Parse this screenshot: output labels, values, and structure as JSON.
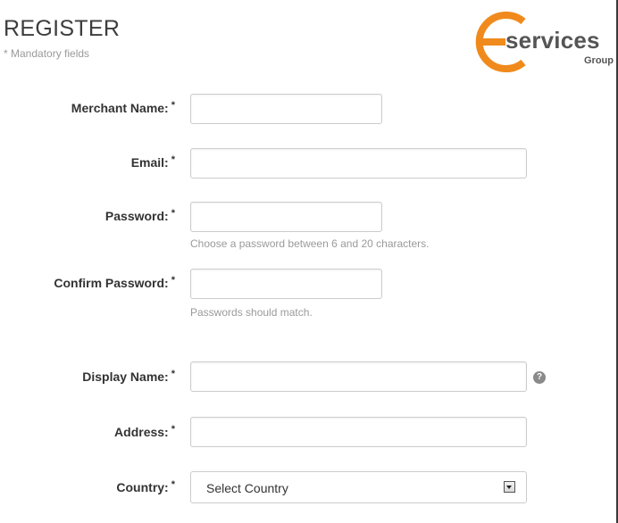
{
  "header": {
    "title": "REGISTER",
    "mandatory_note": "* Mandatory fields"
  },
  "logo": {
    "word": "services",
    "sub": "Group",
    "accent_color": "#f08a1c"
  },
  "form": {
    "required_marker": "*",
    "fields": {
      "merchant_name": {
        "label": "Merchant Name:",
        "value": ""
      },
      "email": {
        "label": "Email:",
        "value": ""
      },
      "password": {
        "label": "Password:",
        "value": "",
        "hint": "Choose a password between 6 and 20 characters."
      },
      "confirm_password": {
        "label": "Confirm Password:",
        "value": "",
        "hint": "Passwords should match."
      },
      "display_name": {
        "label": "Display Name:",
        "value": "",
        "help_icon": "help-icon",
        "help_glyph": "?"
      },
      "address": {
        "label": "Address:",
        "value": ""
      },
      "country": {
        "label": "Country:",
        "selected": "Select Country",
        "arrow_icon": "dropdown-arrow-icon"
      }
    }
  }
}
